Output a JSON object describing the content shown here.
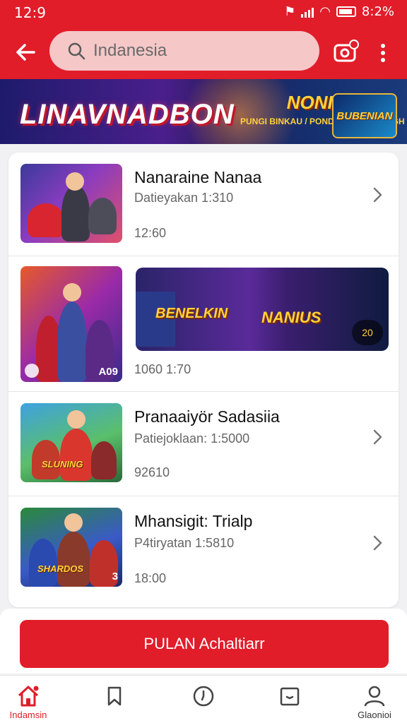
{
  "status_bar": {
    "time": "12:9",
    "right_text": "8:2%"
  },
  "search": {
    "value": "Indanesia"
  },
  "banner": {
    "title": "LINAVNADBON",
    "subtitle": "NONIEH",
    "subtitle_small": "PUNGI BINKAU / PONDE FOUS SHUKGH",
    "logo_text": "BUBENIAN"
  },
  "list": {
    "items": [
      {
        "title": "Nanaraine Nanaa",
        "subtitle": "Datieyakan 1:310",
        "time": "12:60"
      },
      {
        "time": "1060 1:70",
        "thumb_badge": "A09",
        "wide_left": "BENELKIN",
        "wide_right": "NANIUS",
        "wide_badge": "20"
      },
      {
        "title": "Pranaaiyör Sadasiia",
        "subtitle": "Patiejoklaan: 1:5000",
        "time": "92610"
      },
      {
        "title": "Mhansigit: Trialp",
        "subtitle": "P4tiryatan 1:5810",
        "time": "18:00"
      }
    ]
  },
  "thumb_labels": [
    "SLUNING",
    "SHARDOS"
  ],
  "thumb_badge_4": "3",
  "cta": {
    "label": "PULAN Achaltiarr"
  },
  "bottom_nav": {
    "left_label": "Indamsin",
    "right_label": "Glaonioi"
  },
  "colors": {
    "brand_red": "#e11d2a"
  },
  "icons": [
    "back-arrow",
    "search",
    "camera",
    "more-vertical",
    "chevron-right",
    "home",
    "bookmark",
    "compass",
    "bag",
    "profile"
  ]
}
